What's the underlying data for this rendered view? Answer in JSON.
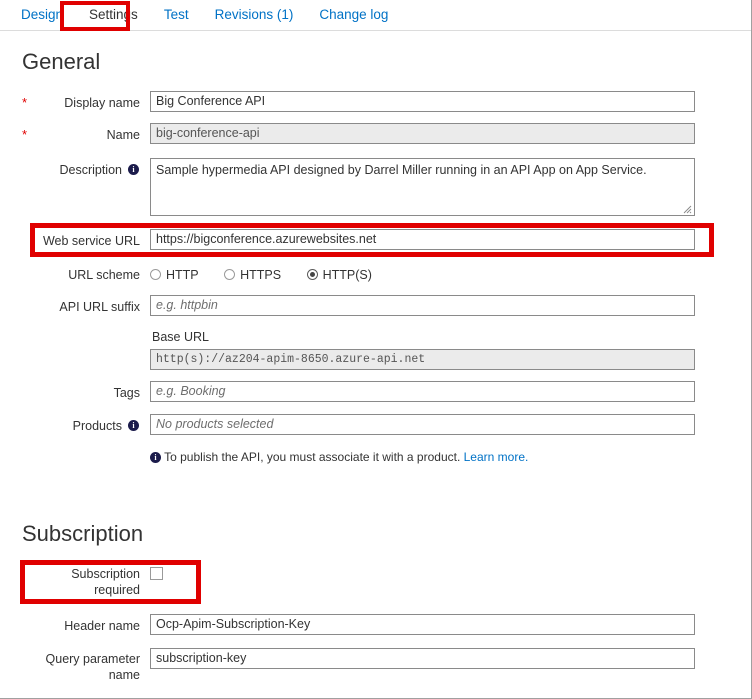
{
  "tabs": [
    {
      "label": "Design",
      "active": false
    },
    {
      "label": "Settings",
      "active": true
    },
    {
      "label": "Test",
      "active": false
    },
    {
      "label": "Revisions (1)",
      "active": false
    },
    {
      "label": "Change log",
      "active": false
    }
  ],
  "general": {
    "heading": "General",
    "display_name": {
      "label": "Display name",
      "required_marker": "*",
      "value": "Big Conference API"
    },
    "name": {
      "label": "Name",
      "required_marker": "*",
      "value": "big-conference-api"
    },
    "description": {
      "label": "Description",
      "value": "Sample hypermedia API designed by Darrel Miller running in an API App on App Service."
    },
    "web_service_url": {
      "label": "Web service URL",
      "value": "https://bigconference.azurewebsites.net"
    },
    "url_scheme": {
      "label": "URL scheme",
      "options": [
        {
          "label": "HTTP",
          "selected": false
        },
        {
          "label": "HTTPS",
          "selected": false
        },
        {
          "label": "HTTP(S)",
          "selected": true
        }
      ]
    },
    "api_url_suffix": {
      "label": "API URL suffix",
      "placeholder": "e.g. httpbin",
      "value": ""
    },
    "base_url": {
      "label": "Base URL",
      "value": "http(s)://az204-apim-8650.azure-api.net"
    },
    "tags": {
      "label": "Tags",
      "placeholder": "e.g. Booking",
      "value": ""
    },
    "products": {
      "label": "Products",
      "placeholder": "No products selected",
      "value": ""
    },
    "products_note": {
      "text": "To publish the API, you must associate it with a product.",
      "link_text": "Learn more."
    }
  },
  "subscription": {
    "heading": "Subscription",
    "required": {
      "label_line1": "Subscription",
      "label_line2": "required",
      "checked": false
    },
    "header_name": {
      "label": "Header name",
      "value": "Ocp-Apim-Subscription-Key"
    },
    "query_parameter_name": {
      "label_line1": "Query parameter",
      "label_line2": "name",
      "value": "subscription-key"
    }
  },
  "icons": {
    "info": "i"
  },
  "colors": {
    "highlight": "#e00000",
    "link": "#0072c6",
    "required": "#e00000"
  }
}
